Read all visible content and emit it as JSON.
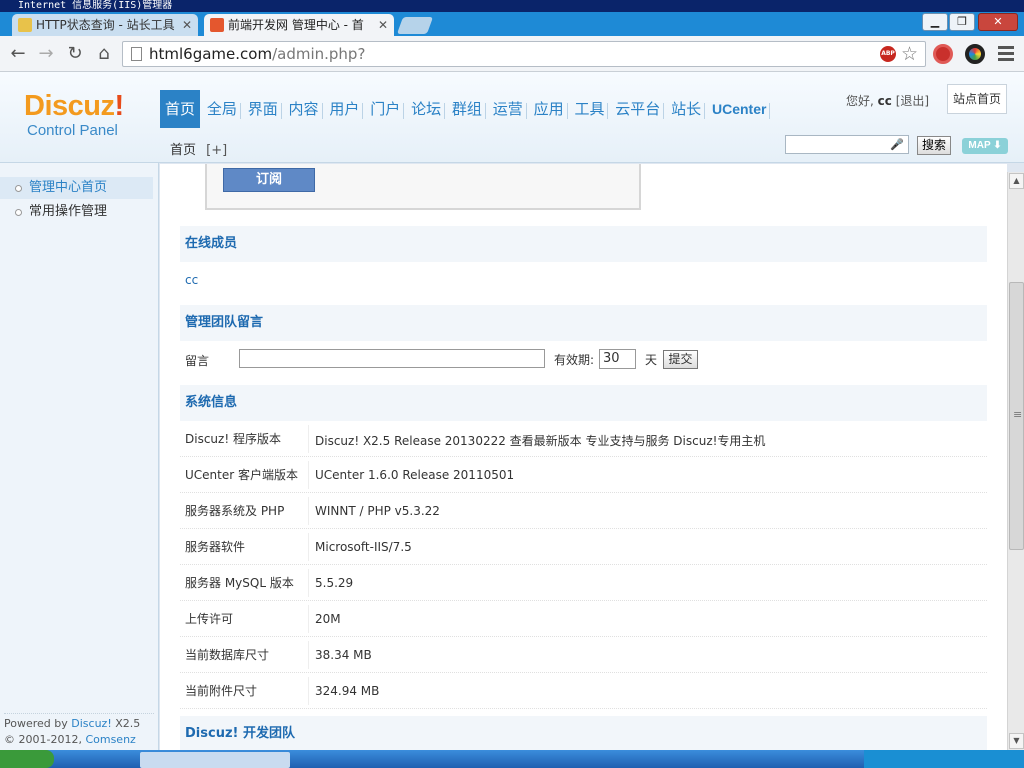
{
  "os_window": {
    "title": "Internet 信息服务(IIS)管理器"
  },
  "browser": {
    "tabs": [
      {
        "label": "HTTP状态查询 - 站长工具",
        "active": false
      },
      {
        "label": "前端开发网 管理中心 - 首",
        "active": true
      }
    ],
    "url_host": "html6game.com",
    "url_path": "/admin.php?",
    "abp_label": "ABP",
    "window_buttons": {
      "minimize": "▁",
      "restore": "❐",
      "close": "✕"
    }
  },
  "header": {
    "logo_main": "Discuz",
    "logo_bang": "!",
    "logo_sub": "Control Panel",
    "nav": [
      "首页",
      "全局",
      "界面",
      "内容",
      "用户",
      "门户",
      "论坛",
      "群组",
      "运营",
      "应用",
      "工具",
      "云平台",
      "站长",
      "UCenter"
    ],
    "greeting": "您好,",
    "username": "cc",
    "logout": "[退出]",
    "site_home": "站点首页",
    "breadcrumb": "首页",
    "breadcrumb_add": "[+]",
    "search_button": "搜索",
    "map_button": "MAP ⬇"
  },
  "sidebar": {
    "items": [
      {
        "label": "管理中心首页",
        "active": true
      },
      {
        "label": "常用操作管理",
        "active": false
      }
    ],
    "powered_by": "Powered by",
    "powered_link": "Discuz!",
    "powered_version": "X2.5",
    "copyright": "© 2001-2012,",
    "copyright_link": "Comsenz Inc."
  },
  "main": {
    "subscribe_button": "订阅",
    "online_title": "在线成员",
    "online_user": "cc",
    "team_title": "管理团队留言",
    "message_label": "留言",
    "message_value": "",
    "expiry_label": "有效期:",
    "expiry_value": "30",
    "day_label": "天",
    "submit_button": "提交",
    "sysinfo_title": "系统信息",
    "sysinfo": [
      {
        "key": "Discuz! 程序版本",
        "value": "Discuz! X2.5 Release 20130222 查看最新版本 专业支持与服务 Discuz!专用主机"
      },
      {
        "key": "UCenter 客户端版本",
        "value": "UCenter 1.6.0 Release 20110501"
      },
      {
        "key": "服务器系统及 PHP",
        "value": "WINNT / PHP v5.3.22"
      },
      {
        "key": "服务器软件",
        "value": "Microsoft-IIS/7.5"
      },
      {
        "key": "服务器 MySQL 版本",
        "value": "5.5.29"
      },
      {
        "key": "上传许可",
        "value": "20M"
      },
      {
        "key": "当前数据库尺寸",
        "value": "38.34 MB"
      },
      {
        "key": "当前附件尺寸",
        "value": "324.94 MB"
      }
    ],
    "devteam_title": "Discuz! 开发团队"
  }
}
